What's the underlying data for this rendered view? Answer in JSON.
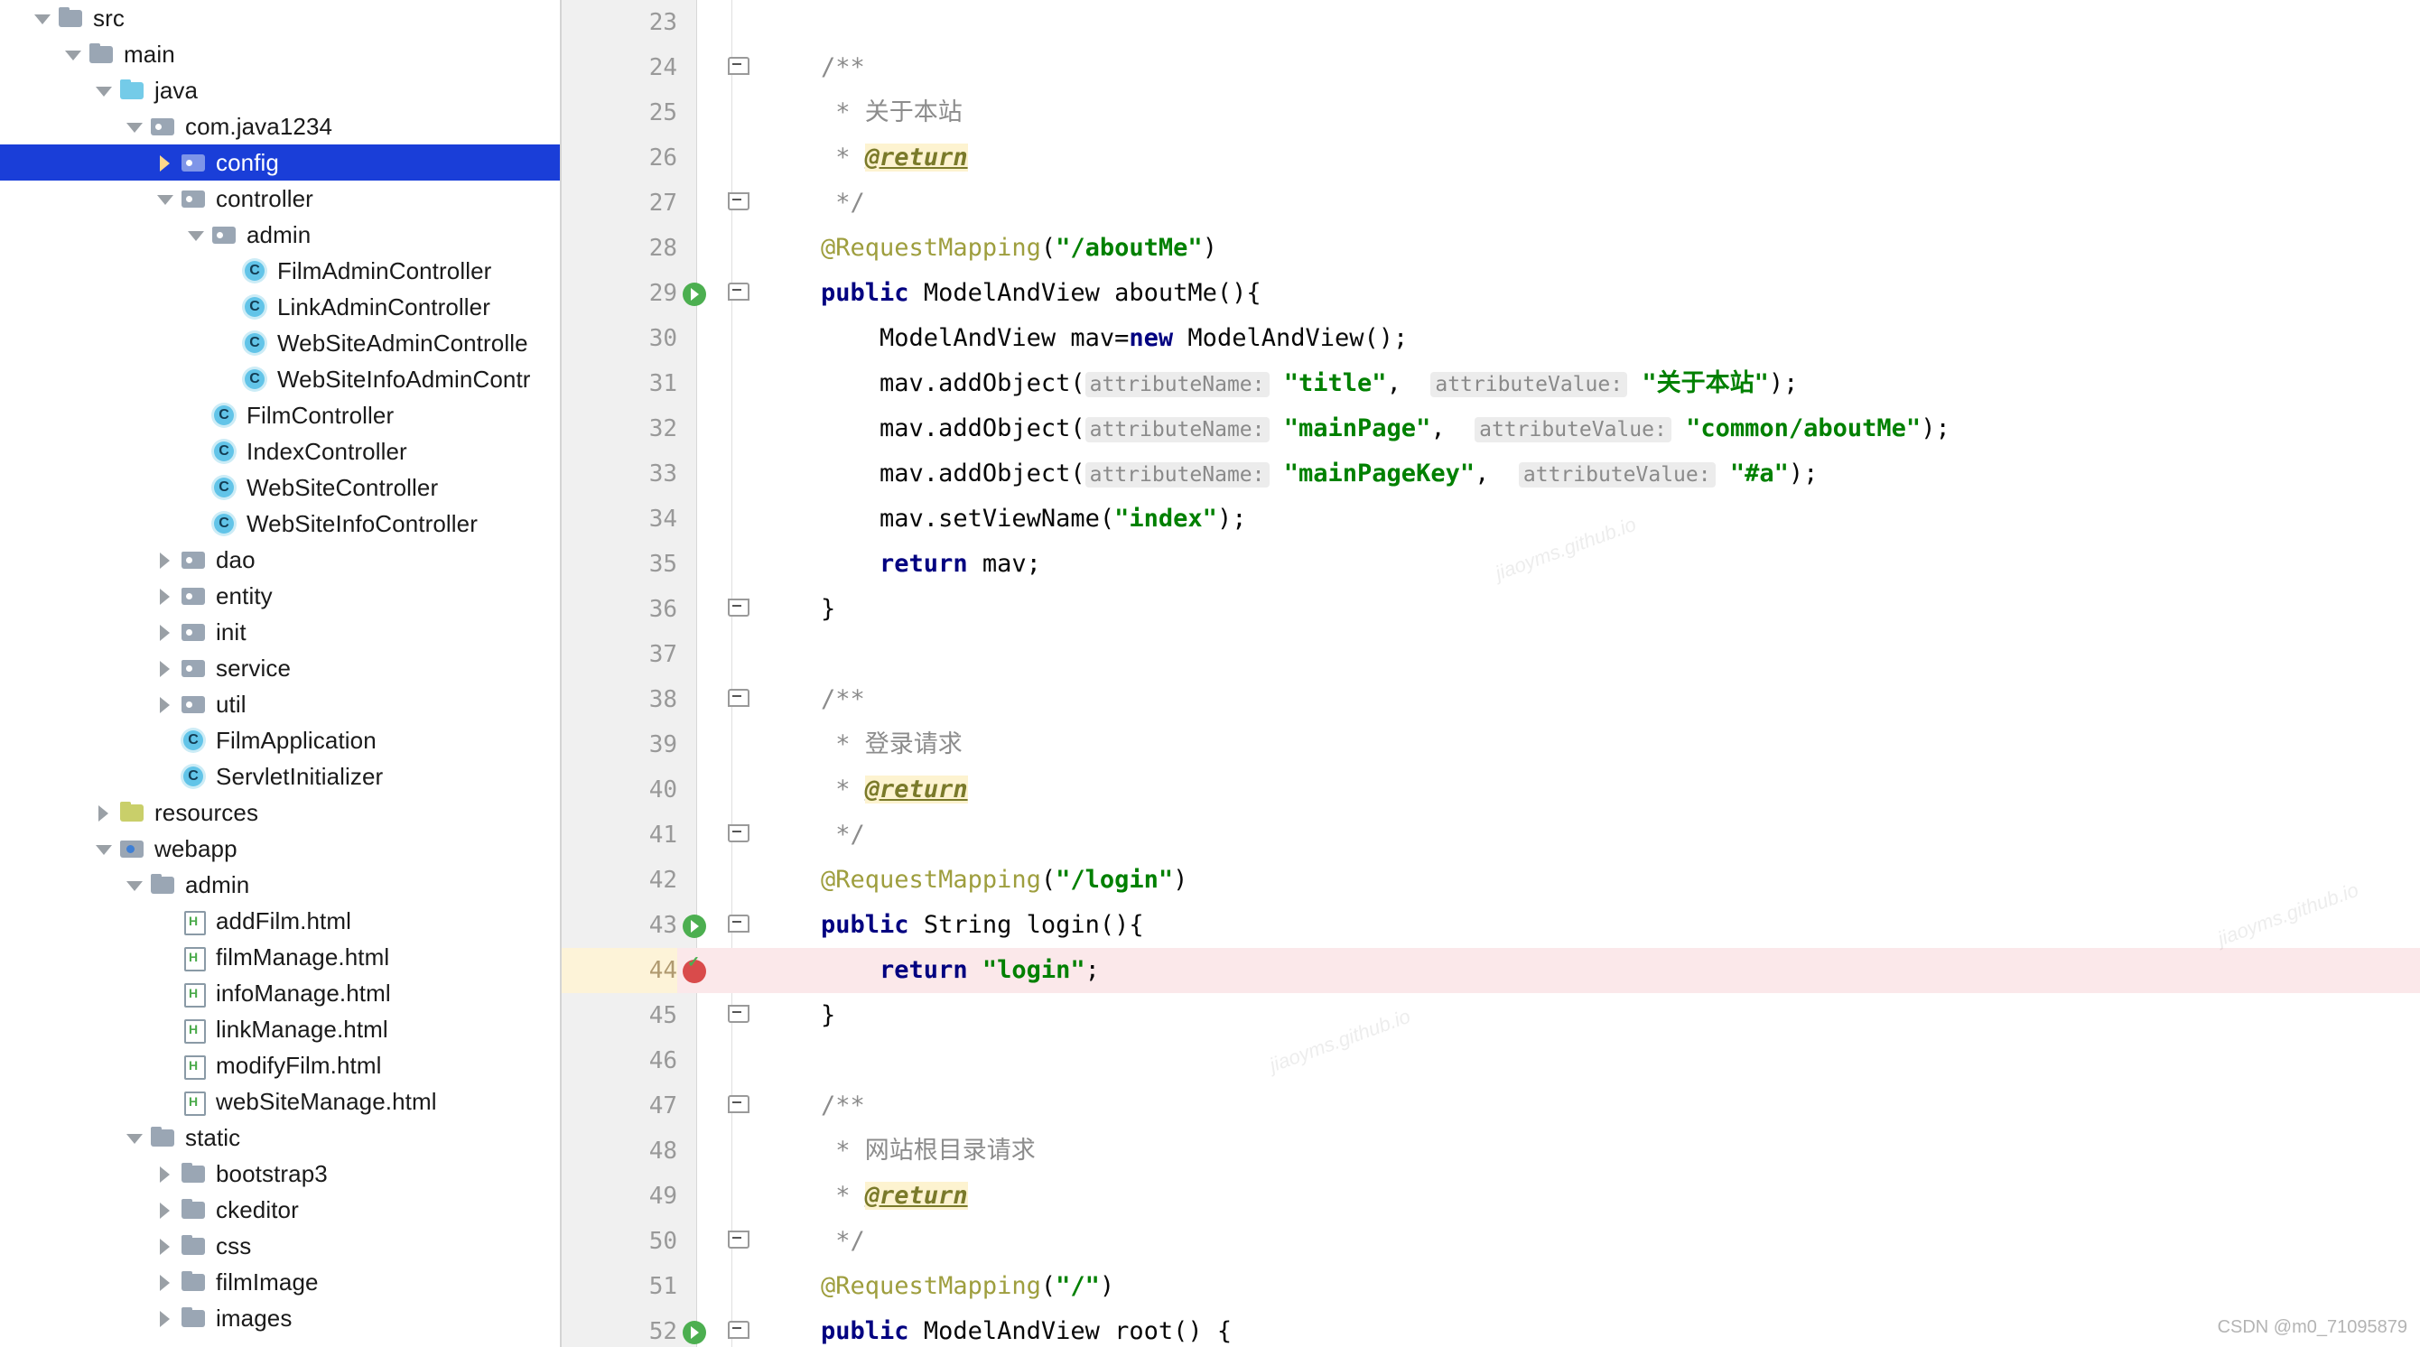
{
  "tree": {
    "name": "project-tree",
    "items": [
      {
        "label": "src",
        "depth": 0,
        "arrow": "down",
        "icon": "folder",
        "selected": false
      },
      {
        "label": "main",
        "depth": 1,
        "arrow": "down",
        "icon": "folder",
        "selected": false
      },
      {
        "label": "java",
        "depth": 2,
        "arrow": "down",
        "icon": "folder-blue",
        "selected": false
      },
      {
        "label": "com.java1234",
        "depth": 3,
        "arrow": "down",
        "icon": "pkg",
        "selected": false
      },
      {
        "label": "config",
        "depth": 4,
        "arrow": "right",
        "icon": "pkg",
        "selected": true
      },
      {
        "label": "controller",
        "depth": 4,
        "arrow": "down",
        "icon": "pkg",
        "selected": false
      },
      {
        "label": "admin",
        "depth": 5,
        "arrow": "down",
        "icon": "pkg",
        "selected": false
      },
      {
        "label": "FilmAdminController",
        "depth": 6,
        "arrow": "none",
        "icon": "cls",
        "selected": false
      },
      {
        "label": "LinkAdminController",
        "depth": 6,
        "arrow": "none",
        "icon": "cls",
        "selected": false
      },
      {
        "label": "WebSiteAdminControlle",
        "depth": 6,
        "arrow": "none",
        "icon": "cls",
        "selected": false
      },
      {
        "label": "WebSiteInfoAdminContr",
        "depth": 6,
        "arrow": "none",
        "icon": "cls",
        "selected": false
      },
      {
        "label": "FilmController",
        "depth": 5,
        "arrow": "none",
        "icon": "cls",
        "selected": false
      },
      {
        "label": "IndexController",
        "depth": 5,
        "arrow": "none",
        "icon": "cls",
        "selected": false
      },
      {
        "label": "WebSiteController",
        "depth": 5,
        "arrow": "none",
        "icon": "cls",
        "selected": false
      },
      {
        "label": "WebSiteInfoController",
        "depth": 5,
        "arrow": "none",
        "icon": "cls",
        "selected": false
      },
      {
        "label": "dao",
        "depth": 4,
        "arrow": "right",
        "icon": "pkg",
        "selected": false
      },
      {
        "label": "entity",
        "depth": 4,
        "arrow": "right",
        "icon": "pkg",
        "selected": false
      },
      {
        "label": "init",
        "depth": 4,
        "arrow": "right",
        "icon": "pkg",
        "selected": false
      },
      {
        "label": "service",
        "depth": 4,
        "arrow": "right",
        "icon": "pkg",
        "selected": false
      },
      {
        "label": "util",
        "depth": 4,
        "arrow": "right",
        "icon": "pkg",
        "selected": false
      },
      {
        "label": "FilmApplication",
        "depth": 4,
        "arrow": "none",
        "icon": "cls-spring",
        "selected": false
      },
      {
        "label": "ServletInitializer",
        "depth": 4,
        "arrow": "none",
        "icon": "cls",
        "selected": false
      },
      {
        "label": "resources",
        "depth": 2,
        "arrow": "right",
        "icon": "folder-res",
        "selected": false
      },
      {
        "label": "webapp",
        "depth": 2,
        "arrow": "down",
        "icon": "folder-web",
        "selected": false
      },
      {
        "label": "admin",
        "depth": 3,
        "arrow": "down",
        "icon": "folder",
        "selected": false
      },
      {
        "label": "addFilm.html",
        "depth": 4,
        "arrow": "none",
        "icon": "html",
        "selected": false
      },
      {
        "label": "filmManage.html",
        "depth": 4,
        "arrow": "none",
        "icon": "html",
        "selected": false
      },
      {
        "label": "infoManage.html",
        "depth": 4,
        "arrow": "none",
        "icon": "html",
        "selected": false
      },
      {
        "label": "linkManage.html",
        "depth": 4,
        "arrow": "none",
        "icon": "html",
        "selected": false
      },
      {
        "label": "modifyFilm.html",
        "depth": 4,
        "arrow": "none",
        "icon": "html",
        "selected": false
      },
      {
        "label": "webSiteManage.html",
        "depth": 4,
        "arrow": "none",
        "icon": "html",
        "selected": false
      },
      {
        "label": "static",
        "depth": 3,
        "arrow": "down",
        "icon": "folder",
        "selected": false
      },
      {
        "label": "bootstrap3",
        "depth": 4,
        "arrow": "right",
        "icon": "folder",
        "selected": false
      },
      {
        "label": "ckeditor",
        "depth": 4,
        "arrow": "right",
        "icon": "folder",
        "selected": false
      },
      {
        "label": "css",
        "depth": 4,
        "arrow": "right",
        "icon": "folder",
        "selected": false
      },
      {
        "label": "filmImage",
        "depth": 4,
        "arrow": "right",
        "icon": "folder",
        "selected": false
      },
      {
        "label": "images",
        "depth": 4,
        "arrow": "right",
        "icon": "folder",
        "selected": false
      }
    ]
  },
  "editor": {
    "name": "code-editor",
    "first_line_number": 23,
    "lines": [
      {
        "n": 23,
        "gutter_icon": "none",
        "fold": "none",
        "highlight": false,
        "tokens": []
      },
      {
        "n": 24,
        "gutter_icon": "none",
        "fold": "open",
        "highlight": false,
        "tokens": [
          {
            "t": "cmt",
            "v": "    /**"
          }
        ]
      },
      {
        "n": 25,
        "gutter_icon": "none",
        "fold": "none",
        "highlight": false,
        "tokens": [
          {
            "t": "cmt",
            "v": "     * 关于本站"
          }
        ]
      },
      {
        "n": 26,
        "gutter_icon": "none",
        "fold": "none",
        "highlight": false,
        "tokens": [
          {
            "t": "cmt",
            "v": "     * "
          },
          {
            "t": "tag",
            "v": "@return"
          }
        ]
      },
      {
        "n": 27,
        "gutter_icon": "none",
        "fold": "end",
        "highlight": false,
        "tokens": [
          {
            "t": "cmt",
            "v": "     */"
          }
        ]
      },
      {
        "n": 28,
        "gutter_icon": "none",
        "fold": "none",
        "highlight": false,
        "tokens": [
          {
            "t": "ann",
            "v": "    @RequestMapping"
          },
          {
            "t": "plain",
            "v": "("
          },
          {
            "t": "str",
            "v": "\"/aboutMe\""
          },
          {
            "t": "plain",
            "v": ")"
          }
        ]
      },
      {
        "n": 29,
        "gutter_icon": "run",
        "fold": "open",
        "highlight": false,
        "tokens": [
          {
            "t": "kw",
            "v": "    public"
          },
          {
            "t": "plain",
            "v": " ModelAndView aboutMe(){"
          }
        ]
      },
      {
        "n": 30,
        "gutter_icon": "none",
        "fold": "none",
        "highlight": false,
        "tokens": [
          {
            "t": "plain",
            "v": "        ModelAndView mav="
          },
          {
            "t": "kw",
            "v": "new"
          },
          {
            "t": "plain",
            "v": " ModelAndView();"
          }
        ]
      },
      {
        "n": 31,
        "gutter_icon": "none",
        "fold": "none",
        "highlight": false,
        "tokens": [
          {
            "t": "plain",
            "v": "        mav.addObject("
          },
          {
            "t": "hint",
            "v": "attributeName:"
          },
          {
            "t": "plain",
            "v": " "
          },
          {
            "t": "str",
            "v": "\"title\""
          },
          {
            "t": "plain",
            "v": ",  "
          },
          {
            "t": "hint",
            "v": "attributeValue:"
          },
          {
            "t": "plain",
            "v": " "
          },
          {
            "t": "str",
            "v": "\"关于本站\""
          },
          {
            "t": "plain",
            "v": ");"
          }
        ]
      },
      {
        "n": 32,
        "gutter_icon": "none",
        "fold": "none",
        "highlight": false,
        "tokens": [
          {
            "t": "plain",
            "v": "        mav.addObject("
          },
          {
            "t": "hint",
            "v": "attributeName:"
          },
          {
            "t": "plain",
            "v": " "
          },
          {
            "t": "str",
            "v": "\"mainPage\""
          },
          {
            "t": "plain",
            "v": ",  "
          },
          {
            "t": "hint",
            "v": "attributeValue:"
          },
          {
            "t": "plain",
            "v": " "
          },
          {
            "t": "str",
            "v": "\"common/aboutMe\""
          },
          {
            "t": "plain",
            "v": ");"
          }
        ]
      },
      {
        "n": 33,
        "gutter_icon": "none",
        "fold": "none",
        "highlight": false,
        "tokens": [
          {
            "t": "plain",
            "v": "        mav.addObject("
          },
          {
            "t": "hint",
            "v": "attributeName:"
          },
          {
            "t": "plain",
            "v": " "
          },
          {
            "t": "str",
            "v": "\"mainPageKey\""
          },
          {
            "t": "plain",
            "v": ",  "
          },
          {
            "t": "hint",
            "v": "attributeValue:"
          },
          {
            "t": "plain",
            "v": " "
          },
          {
            "t": "str",
            "v": "\"#a\""
          },
          {
            "t": "plain",
            "v": ");"
          }
        ]
      },
      {
        "n": 34,
        "gutter_icon": "none",
        "fold": "none",
        "highlight": false,
        "tokens": [
          {
            "t": "plain",
            "v": "        mav.setViewName("
          },
          {
            "t": "str",
            "v": "\"index\""
          },
          {
            "t": "plain",
            "v": ");"
          }
        ]
      },
      {
        "n": 35,
        "gutter_icon": "none",
        "fold": "none",
        "highlight": false,
        "tokens": [
          {
            "t": "kw",
            "v": "        return"
          },
          {
            "t": "plain",
            "v": " mav;"
          }
        ]
      },
      {
        "n": 36,
        "gutter_icon": "none",
        "fold": "end",
        "highlight": false,
        "tokens": [
          {
            "t": "plain",
            "v": "    }"
          }
        ]
      },
      {
        "n": 37,
        "gutter_icon": "none",
        "fold": "none",
        "highlight": false,
        "tokens": []
      },
      {
        "n": 38,
        "gutter_icon": "none",
        "fold": "open",
        "highlight": false,
        "tokens": [
          {
            "t": "cmt",
            "v": "    /**"
          }
        ]
      },
      {
        "n": 39,
        "gutter_icon": "none",
        "fold": "none",
        "highlight": false,
        "tokens": [
          {
            "t": "cmt",
            "v": "     * 登录请求"
          }
        ]
      },
      {
        "n": 40,
        "gutter_icon": "none",
        "fold": "none",
        "highlight": false,
        "tokens": [
          {
            "t": "cmt",
            "v": "     * "
          },
          {
            "t": "tag",
            "v": "@return"
          }
        ]
      },
      {
        "n": 41,
        "gutter_icon": "none",
        "fold": "end",
        "highlight": false,
        "tokens": [
          {
            "t": "cmt",
            "v": "     */"
          }
        ]
      },
      {
        "n": 42,
        "gutter_icon": "none",
        "fold": "none",
        "highlight": false,
        "tokens": [
          {
            "t": "ann",
            "v": "    @RequestMapping"
          },
          {
            "t": "plain",
            "v": "("
          },
          {
            "t": "str",
            "v": "\"/login\""
          },
          {
            "t": "plain",
            "v": ")"
          }
        ]
      },
      {
        "n": 43,
        "gutter_icon": "run",
        "fold": "open",
        "highlight": false,
        "tokens": [
          {
            "t": "kw",
            "v": "    public"
          },
          {
            "t": "plain",
            "v": " String login(){"
          }
        ]
      },
      {
        "n": 44,
        "gutter_icon": "breakpoint",
        "fold": "none",
        "highlight": true,
        "tokens": [
          {
            "t": "kw",
            "v": "        return"
          },
          {
            "t": "plain",
            "v": " "
          },
          {
            "t": "str",
            "v": "\"login\""
          },
          {
            "t": "plain",
            "v": ";"
          }
        ]
      },
      {
        "n": 45,
        "gutter_icon": "none",
        "fold": "end",
        "highlight": false,
        "tokens": [
          {
            "t": "plain",
            "v": "    }"
          }
        ]
      },
      {
        "n": 46,
        "gutter_icon": "none",
        "fold": "none",
        "highlight": false,
        "tokens": []
      },
      {
        "n": 47,
        "gutter_icon": "none",
        "fold": "open",
        "highlight": false,
        "tokens": [
          {
            "t": "cmt",
            "v": "    /**"
          }
        ]
      },
      {
        "n": 48,
        "gutter_icon": "none",
        "fold": "none",
        "highlight": false,
        "tokens": [
          {
            "t": "cmt",
            "v": "     * 网站根目录请求"
          }
        ]
      },
      {
        "n": 49,
        "gutter_icon": "none",
        "fold": "none",
        "highlight": false,
        "tokens": [
          {
            "t": "cmt",
            "v": "     * "
          },
          {
            "t": "tag",
            "v": "@return"
          }
        ]
      },
      {
        "n": 50,
        "gutter_icon": "none",
        "fold": "end",
        "highlight": false,
        "tokens": [
          {
            "t": "cmt",
            "v": "     */"
          }
        ]
      },
      {
        "n": 51,
        "gutter_icon": "none",
        "fold": "none",
        "highlight": false,
        "tokens": [
          {
            "t": "ann",
            "v": "    @RequestMapping"
          },
          {
            "t": "plain",
            "v": "("
          },
          {
            "t": "str",
            "v": "\"/\""
          },
          {
            "t": "plain",
            "v": ")"
          }
        ]
      },
      {
        "n": 52,
        "gutter_icon": "run",
        "fold": "open",
        "highlight": false,
        "tokens": [
          {
            "t": "kw",
            "v": "    public"
          },
          {
            "t": "plain",
            "v": " ModelAndView root() {"
          }
        ]
      }
    ]
  },
  "watermark": {
    "label": "CSDN @m0_71095879",
    "ghost": "jiaoyms.github.io"
  },
  "colors": {
    "selection": "#1a3ed8",
    "gutter_bg": "#f0f0f0",
    "line_number": "#999999",
    "keyword": "#000080",
    "string": "#008000",
    "comment": "#8c8c8c",
    "annotation": "#9e9e3e",
    "javadoc_tag": "#7a7a2a",
    "error_line": "#fbe8ea",
    "hint_bg": "#ececec"
  }
}
